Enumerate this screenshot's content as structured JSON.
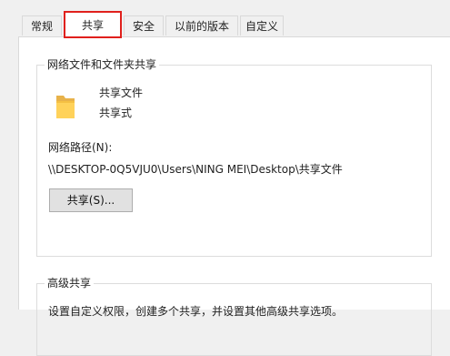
{
  "tabs": [
    {
      "label": "常规"
    },
    {
      "label": "共享"
    },
    {
      "label": "安全"
    },
    {
      "label": "以前的版本"
    },
    {
      "label": "自定义"
    }
  ],
  "active_tab": "共享",
  "active_tab_highlight_color": "#e0201c",
  "network_share": {
    "group_title": "网络文件和文件夹共享",
    "folder_icon": "folder-icon",
    "folder_name": "共享文件",
    "share_state": "共享式",
    "path_label": "网络路径(N):",
    "path_value": "\\\\DESKTOP-0Q5VJU0\\Users\\NING MEI\\Desktop\\共享文件",
    "share_button": "共享(S)..."
  },
  "advanced_share": {
    "group_title": "高级共享",
    "description": "设置自定义权限，创建多个共享，并设置其他高级共享选项。"
  }
}
